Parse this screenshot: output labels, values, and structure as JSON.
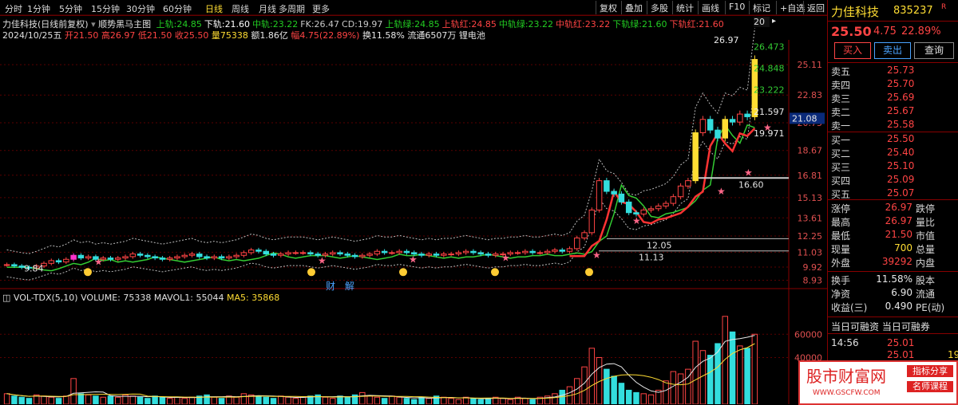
{
  "toolbar": {
    "periods": [
      "分时",
      "1分钟",
      "5分钟",
      "15分钟",
      "30分钟",
      "60分钟",
      "日线",
      "周线",
      "月线",
      "多周期",
      "更多"
    ],
    "active": "日线",
    "right_buttons": [
      "复权",
      "叠加",
      "多股",
      "统计",
      "画线",
      "F10",
      "标记",
      "+自选",
      "返回"
    ]
  },
  "chart_header": {
    "name": "力佳科技(日线前复权)",
    "indicator_name": "顺势黑马主图",
    "items": [
      {
        "label": "上轨:",
        "value": "24.85",
        "color": "#22cc22"
      },
      {
        "label": "下轨:",
        "value": "21.60",
        "color": "#ffffff"
      },
      {
        "label": "中轨:",
        "value": "23.22",
        "color": "#22cc22"
      },
      {
        "label": "FK:",
        "value": "26.47",
        "color": "#c8c8c8"
      },
      {
        "label": "CD:",
        "value": "19.97",
        "color": "#c8c8c8"
      },
      {
        "label": "上轨绿:",
        "value": "24.85",
        "color": "#22cc22"
      },
      {
        "label": "上轨红:",
        "value": "24.85",
        "color": "#ff4444"
      },
      {
        "label": "中轨绿:",
        "value": "23.22",
        "color": "#22cc22"
      },
      {
        "label": "中轨红:",
        "value": "23.22",
        "color": "#ff4444"
      },
      {
        "label": "下轨绿:",
        "value": "21.60",
        "color": "#22cc22"
      },
      {
        "label": "下轨红:",
        "value": "21.60",
        "color": "#ff4444"
      }
    ],
    "ellipsis": "20"
  },
  "day_info": {
    "date": "2024/10/25五",
    "open_label": "开",
    "open": "21.50",
    "high_label": "高",
    "high": "26.97",
    "low_label": "低",
    "low": "21.50",
    "close_label": "收",
    "close": "25.50",
    "vol_label": "量",
    "vol": "75338",
    "amt_label": "额",
    "amt": "1.86亿",
    "chg_label": "幅",
    "chg": "4.75(22.89%)",
    "turnover_label": "换",
    "turnover": "11.58%",
    "float_label": "流通",
    "float": "6507万",
    "concept": "锂电池"
  },
  "price_axis": [
    "25.11",
    "22.83",
    "20.75",
    "18.67",
    "16.81",
    "15.13",
    "13.61",
    "12.25",
    "11.03",
    "9.92",
    "8.93"
  ],
  "current_price_tag": "21.08",
  "annotations": {
    "max_label": "26.97",
    "min_label": "9.84",
    "band_labels": [
      "26.473",
      "24.848",
      "23.222",
      "21.597",
      "19.971"
    ],
    "line1_label": "16.60",
    "line2_label": "12.05",
    "line3_label": "11.13",
    "caijie": "财　解"
  },
  "volume_header": {
    "name": "VOL-TDX(5,10)",
    "volume_label": "VOLUME:",
    "volume": "75338",
    "mavol_label": "MAVOL1:",
    "mavol": "55044",
    "ma5_label": "MA5:",
    "ma5": "35868"
  },
  "volume_axis": [
    "60000",
    "40000"
  ],
  "chart_data": {
    "type": "candlestick",
    "price_ylim": [
      8.9,
      26.97
    ],
    "close_series_approx": [
      10.1,
      10.0,
      9.9,
      9.84,
      10.0,
      10.2,
      10.4,
      10.3,
      10.5,
      10.8,
      10.6,
      10.7,
      10.5,
      10.6,
      10.5,
      10.6,
      10.7,
      10.9,
      10.8,
      10.7,
      10.6,
      10.5,
      10.6,
      10.7,
      10.8,
      10.9,
      10.7,
      10.6,
      10.7,
      10.6,
      10.7,
      10.8,
      11.0,
      11.2,
      11.1,
      10.9,
      10.8,
      10.9,
      11.0,
      11.0,
      11.0,
      10.9,
      10.8,
      10.9,
      11.0,
      10.9,
      10.8,
      10.7,
      10.8,
      10.9,
      11.1,
      11.0,
      11.0,
      11.1,
      11.0,
      10.9,
      10.8,
      10.9,
      10.8,
      10.9,
      10.9,
      11.0,
      11.1,
      11.0,
      10.9,
      10.8,
      10.9,
      10.9,
      11.0,
      11.0,
      11.1,
      11.0,
      11.0,
      11.1,
      11.2,
      11.1,
      11.3,
      12.1,
      12.5,
      14.2,
      16.4,
      15.6,
      15.4,
      14.8,
      14.0,
      13.9,
      14.2,
      14.3,
      14.5,
      14.7,
      15.2,
      16.0,
      16.4,
      20.0,
      21.0,
      20.2,
      19.6,
      21.0,
      20.8,
      21.4,
      21.2,
      25.5
    ],
    "volume_ylim": [
      0,
      80000
    ],
    "volume_approx": [
      9000,
      7000,
      6000,
      5000,
      8000,
      7000,
      6000,
      5000,
      7000,
      22000,
      9000,
      8000,
      7000,
      6000,
      7000,
      6000,
      8000,
      7000,
      6000,
      5000,
      7000,
      6000,
      5000,
      6000,
      5000,
      6000,
      7000,
      8000,
      6000,
      5000,
      7000,
      6000,
      9000,
      8000,
      7000,
      6000,
      5000,
      7000,
      6000,
      5000,
      6000,
      7000,
      8000,
      6000,
      5000,
      7000,
      6000,
      8000,
      10000,
      7000,
      6000,
      5000,
      7000,
      6000,
      5000,
      4000,
      6000,
      5000,
      7000,
      6000,
      5000,
      4000,
      6000,
      5000,
      4000,
      5000,
      6000,
      5000,
      4000,
      6000,
      5000,
      4000,
      6000,
      7000,
      9000,
      12000,
      15000,
      22000,
      32000,
      48000,
      40000,
      30000,
      24000,
      18000,
      12000,
      10000,
      9000,
      8000,
      12000,
      20000,
      28000,
      26000,
      30000,
      54000,
      46000,
      42000,
      52000,
      75338,
      62000,
      50000,
      48000,
      60000
    ],
    "xlabel": "",
    "ylabel": ""
  },
  "quote_panel": {
    "name": "力佳科技",
    "code": "835237",
    "r_mark": "R",
    "price": "25.50",
    "change": "4.75",
    "pct": "22.89%",
    "buttons": [
      "买入",
      "卖出",
      "查询"
    ],
    "asks": [
      {
        "label": "卖五",
        "price": "25.73"
      },
      {
        "label": "卖四",
        "price": "25.70"
      },
      {
        "label": "卖三",
        "price": "25.69"
      },
      {
        "label": "卖二",
        "price": "25.67"
      },
      {
        "label": "卖一",
        "price": "25.58"
      }
    ],
    "bids": [
      {
        "label": "买一",
        "price": "25.50"
      },
      {
        "label": "买二",
        "price": "25.40"
      },
      {
        "label": "买三",
        "price": "25.10"
      },
      {
        "label": "买四",
        "price": "25.09"
      },
      {
        "label": "买五",
        "price": "25.07"
      }
    ],
    "stats": [
      {
        "label": "涨停",
        "value": "26.97",
        "label2": "跌停"
      },
      {
        "label": "最高",
        "value": "26.97",
        "label2": "量比"
      },
      {
        "label": "最低",
        "value": "21.50",
        "label2": "市值"
      },
      {
        "label": "现量",
        "value": "700",
        "label2": "总量"
      },
      {
        "label": "外盘",
        "value": "39292",
        "label2": "内盘"
      }
    ],
    "stats2": [
      {
        "label": "换手",
        "value": "11.58%",
        "label2": "股本"
      },
      {
        "label": "净资",
        "value": "6.90",
        "label2": "流通"
      },
      {
        "label": "收益(三)",
        "value": "0.490",
        "label2": "PE(动)"
      }
    ],
    "margin_title": "当日可融资 当日可融券",
    "ticks": [
      {
        "time": "14:56",
        "price": "25.01"
      },
      {
        "time": "",
        "price": "25.01",
        "vol": "19"
      }
    ]
  },
  "watermark": {
    "title": "股市财富网",
    "tag1": "指标分享",
    "tag2": "名师课程",
    "url": "WWW.GSCFW.COM"
  },
  "colors": {
    "up": "#ff4444",
    "down": "#33dddd",
    "mid": "#ffdd33",
    "bg": "#000000"
  }
}
